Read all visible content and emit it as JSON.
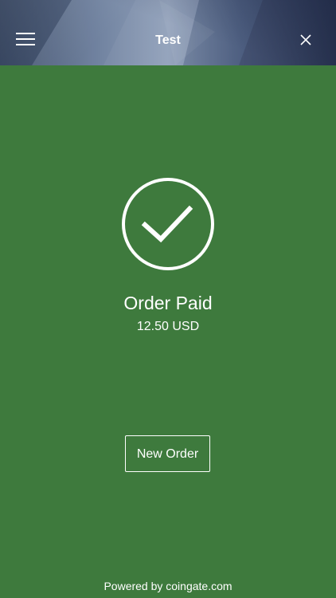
{
  "header": {
    "title": "Test",
    "menu_icon": "hamburger-menu-icon",
    "close_icon": "close-icon"
  },
  "status": {
    "icon": "checkmark-circle-icon",
    "title": "Order Paid",
    "amount": "12.50 USD"
  },
  "actions": {
    "new_order_label": "New Order"
  },
  "footer": {
    "text": "Powered by coingate.com"
  },
  "colors": {
    "background": "#3e7a3d",
    "foreground": "#ffffff"
  }
}
